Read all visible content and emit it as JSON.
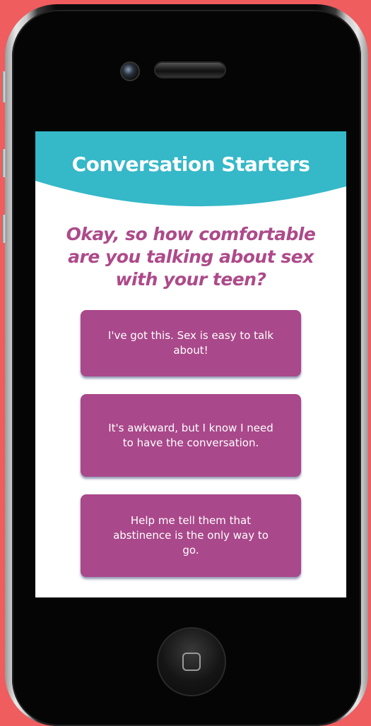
{
  "app": {
    "title": "Conversation Starters"
  },
  "question": "Okay, so how comfortable are you talking about sex with your teen?",
  "options": [
    {
      "label": "I've got this. Sex is easy to talk about!"
    },
    {
      "label": "It's awkward, but I know I need to have the conversation."
    },
    {
      "label": "Help me tell them that abstinence is the only way to go."
    }
  ],
  "colors": {
    "background": "#ef5d5f",
    "header": "#35b8c8",
    "accent": "#ad4a8a",
    "button": "#a9488a",
    "text_on_button": "#ffffff"
  },
  "icons": {
    "camera": "camera-icon",
    "speaker": "speaker-icon",
    "home": "home-button-icon"
  }
}
